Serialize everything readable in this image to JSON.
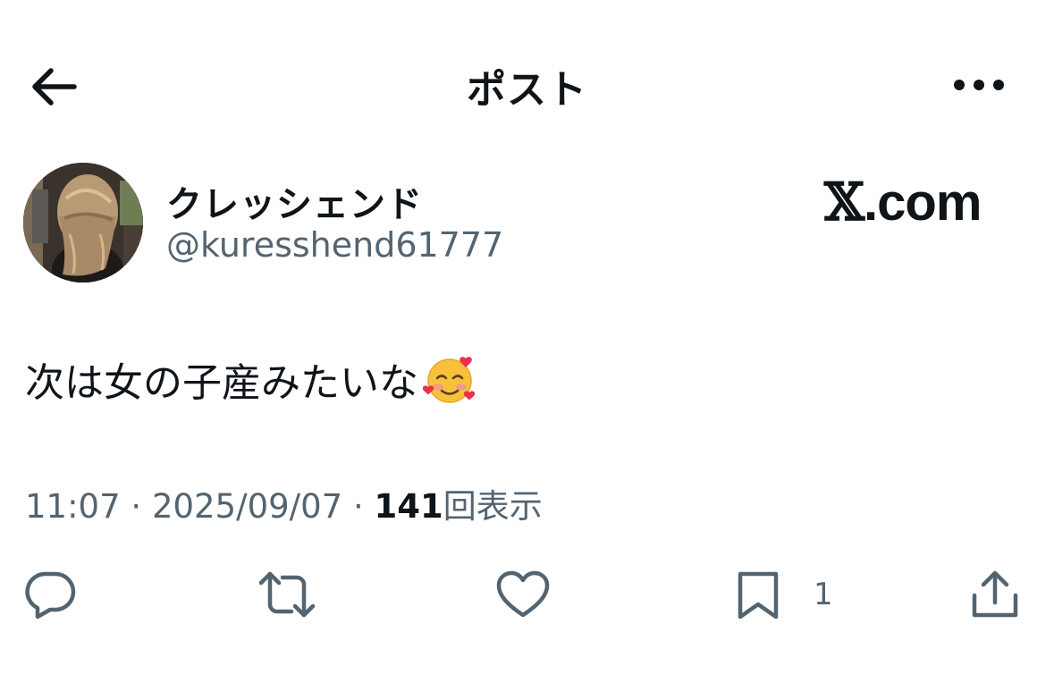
{
  "header": {
    "back_icon": "arrow-left-icon",
    "title": "ポスト",
    "more_icon": "more-horizontal-icon"
  },
  "author": {
    "display_name": "クレッシェンド",
    "handle": "@kuresshend61777"
  },
  "watermark": {
    "x_letter": "𝕏",
    "domain": ".com"
  },
  "post": {
    "text": "次は女の子産みたいな",
    "emoji": "smiling-face-with-hearts"
  },
  "meta": {
    "time": "11:07",
    "separator": " · ",
    "date": "2025/09/07",
    "views_count": "141",
    "views_label": "回表示"
  },
  "actions": {
    "reply_icon": "reply-icon",
    "repost_icon": "repost-icon",
    "like_icon": "heart-icon",
    "bookmark_icon": "bookmark-icon",
    "bookmark_count": "1",
    "share_icon": "share-icon"
  },
  "colors": {
    "text_primary": "#0f1419",
    "text_secondary": "#536471",
    "background": "#ffffff"
  }
}
